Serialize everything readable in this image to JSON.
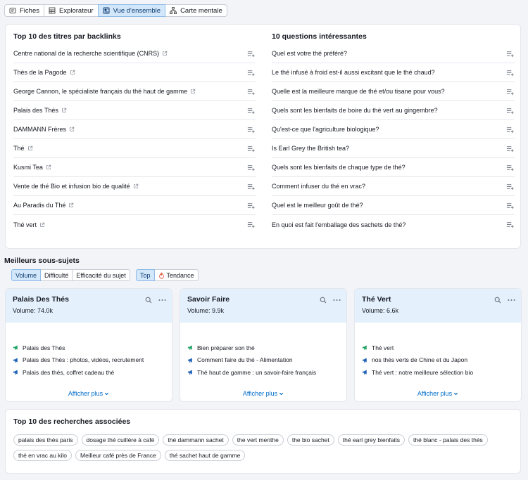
{
  "tabs": [
    {
      "label": "Fiches",
      "icon": "cards-icon",
      "active": false
    },
    {
      "label": "Explorateur",
      "icon": "table-icon",
      "active": false
    },
    {
      "label": "Vue d'ensemble",
      "icon": "overview-icon",
      "active": true
    },
    {
      "label": "Carte mentale",
      "icon": "mindmap-icon",
      "active": false
    }
  ],
  "backlinks": {
    "title": "Top 10 des titres par backlinks",
    "items": [
      "Centre national de la recherche scientifique (CNRS)",
      "Thés de la Pagode",
      "George Cannon, le spécialiste français du thé haut de gamme",
      "Palais des Thés",
      "DAMMANN Frères",
      "Thé",
      "Kusmi Tea",
      "Vente de thé Bio et infusion bio de qualité",
      "Au Paradis du Thé",
      "Thé vert"
    ]
  },
  "questions": {
    "title": "10 questions intéressantes",
    "items": [
      "Quel est votre thé préféré?",
      "Le thé infusé à froid est-il aussi excitant que le thé chaud?",
      "Quelle est la meilleure marque de thé et/ou tisane pour vous?",
      "Quels sont les bienfaits de boire du thé vert au gingembre?",
      "Qu'est-ce que l'agriculture biologique?",
      "Is Earl Grey the British tea?",
      "Quels sont les bienfaits de chaque type de thé?",
      "Comment infuser du thé en vrac?",
      "Quel est le meilleur goût de thé?",
      "En quoi est fait l'emballage des sachets de thé?"
    ]
  },
  "subtopics": {
    "title": "Meilleurs sous-sujets",
    "sort_filters": [
      {
        "label": "Volume",
        "active": true
      },
      {
        "label": "Difficulté",
        "active": false
      },
      {
        "label": "Efficacité du sujet",
        "active": false
      }
    ],
    "mode_filters": [
      {
        "label": "Top",
        "active": true
      },
      {
        "label": "Tendance",
        "active": false
      }
    ],
    "cards": [
      {
        "title": "Palais Des Thés",
        "volume": "Volume: 74.0k",
        "items": [
          {
            "text": "Palais des Thés",
            "color": "#21a365"
          },
          {
            "text": "Palais des Thés : photos, vidéos, recrutement",
            "color": "#1b5fb5"
          },
          {
            "text": "Palais des thés, coffret cadeau thé",
            "color": "#1b5fb5"
          }
        ],
        "more": "Afficher plus"
      },
      {
        "title": "Savoir Faire",
        "volume": "Volume: 9.9k",
        "items": [
          {
            "text": "Bien préparer son thé",
            "color": "#21a365"
          },
          {
            "text": "Comment faire du thé - Alimentation",
            "color": "#1b5fb5"
          },
          {
            "text": "Thé haut de gamme : un savoir-faire français",
            "color": "#1b5fb5"
          }
        ],
        "more": "Afficher plus"
      },
      {
        "title": "Thé Vert",
        "volume": "Volume: 6.6k",
        "items": [
          {
            "text": "Thé vert",
            "color": "#21a365"
          },
          {
            "text": "nos thés verts de Chine et du Japon",
            "color": "#1b5fb5"
          },
          {
            "text": "Thé vert : notre meilleure sélection bio",
            "color": "#1b5fb5"
          }
        ],
        "more": "Afficher plus"
      }
    ]
  },
  "related": {
    "title": "Top 10 des recherches associées",
    "items": [
      "palais des thés paris",
      "dosage thé cuillère à café",
      "thé dammann sachet",
      "the vert menthe",
      "the bio sachet",
      "thé earl grey bienfaits",
      "thé blanc - palais des thés",
      "thé en vrac au kilo",
      "Meilleur café près de France",
      "thé sachet haut de gamme"
    ]
  },
  "colors": {
    "accent": "#006dca",
    "active_bg": "#d3e7fb",
    "card_head_bg": "#e4f1fd"
  }
}
